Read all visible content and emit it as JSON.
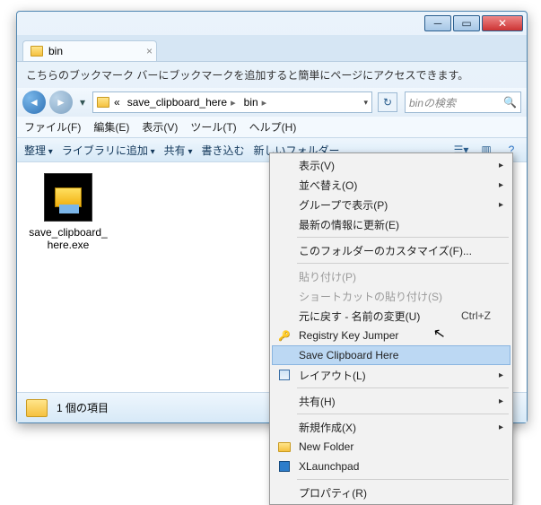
{
  "window": {
    "tab_title": "bin",
    "infobar": "こちらのブックマーク バーにブックマークを追加すると簡単にページにアクセスできます。"
  },
  "breadcrumb": {
    "parent": "save_clipboard_here",
    "current": "bin"
  },
  "search": {
    "placeholder": "binの検索"
  },
  "menubar": {
    "file": "ファイル(F)",
    "edit": "編集(E)",
    "view": "表示(V)",
    "tool": "ツール(T)",
    "help": "ヘルプ(H)"
  },
  "toolbar": {
    "organize": "整理",
    "add_library": "ライブラリに追加",
    "share": "共有",
    "burn": "書き込む",
    "new_folder": "新しいフォルダー"
  },
  "file": {
    "name": "save_clipboard_here.exe"
  },
  "status": {
    "count": "1 個の項目"
  },
  "ctx": {
    "view": "表示(V)",
    "sort": "並べ替え(O)",
    "group": "グループで表示(P)",
    "refresh": "最新の情報に更新(E)",
    "customize": "このフォルダーのカスタマイズ(F)...",
    "paste": "貼り付け(P)",
    "paste_shortcut": "ショートカットの貼り付け(S)",
    "undo": "元に戻す - 名前の変更(U)",
    "undo_sc": "Ctrl+Z",
    "registry": "Registry Key Jumper",
    "save_clip": "Save Clipboard Here",
    "layout": "レイアウト(L)",
    "share": "共有(H)",
    "new": "新規作成(X)",
    "new_folder": "New Folder",
    "xlaunchpad": "XLaunchpad",
    "properties": "プロパティ(R)"
  }
}
